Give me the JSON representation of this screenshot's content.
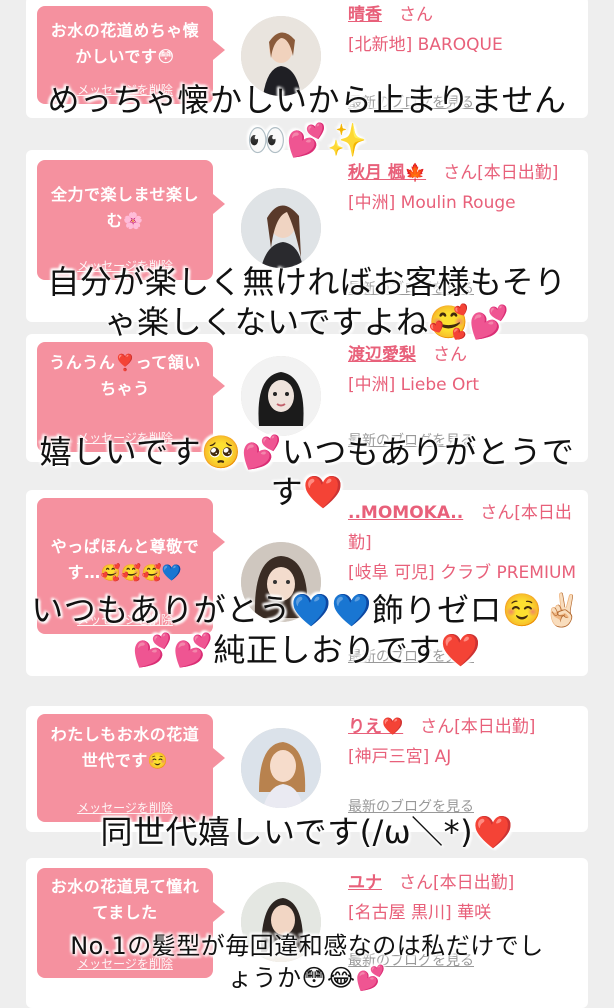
{
  "cards": [
    {
      "message": "お水の花道めちゃ懐かしいです😳",
      "delete_label": "メッセージを削除",
      "name": "晴香",
      "san": "さん",
      "status": "",
      "shop": "[北新地] BAROQUE",
      "blog_label": "最新のブログを見る"
    },
    {
      "message": "全力で楽しませ楽しむ🌸",
      "delete_label": "メッセージを削除",
      "name": "秋月 楓🍁",
      "san": "さん",
      "status": "[本日出勤]",
      "shop": "[中洲] Moulin Rouge",
      "blog_label": "最新のブログを見る"
    },
    {
      "message": "うんうん❣️って頷いちゃう",
      "delete_label": "メッセージを削除",
      "name": "渡辺愛梨",
      "san": "さん",
      "status": "",
      "shop": "[中洲] Liebe Ort",
      "blog_label": "最新のブログを見る"
    },
    {
      "message": "やっぱほんと尊敬です…🥰🥰🥰💙",
      "delete_label": "メッセージを削除",
      "name": "..MOMOKA..",
      "san": "さん",
      "status": "[本日出勤]",
      "shop": "[岐阜 可児] クラブ PREMIUM",
      "blog_label": "最新のブログを見る"
    },
    {
      "message": "わたしもお水の花道世代です☺️",
      "delete_label": "メッセージを削除",
      "name": "りえ❤️",
      "san": "さん",
      "status": "[本日出勤]",
      "shop": "[神戸三宮] AJ",
      "blog_label": "最新のブログを見る"
    },
    {
      "message": "お水の花道見て憧れてました",
      "delete_label": "メッセージを削除",
      "name": "ユナ",
      "san": "さん",
      "status": "[本日出勤]",
      "shop": "[名古屋 黒川] 華咲",
      "blog_label": "最新のブログを見る"
    }
  ],
  "overlays": [
    {
      "line1": "めっちゃ懐かしいから止まりません",
      "line2": "👀💕✨"
    },
    {
      "line1": "自分が楽しく無ければお客様もそり",
      "line2": "ゃ楽しくないですよね🥰💕"
    },
    {
      "line1": "嬉しいです🥺💕いつもありがとうで",
      "line2": "す❤️"
    },
    {
      "line1": "いつもありがとう💙💙飾りゼロ☺️✌🏻",
      "line2": "💕💕純正しおりです❤️"
    },
    {
      "line1": "同世代嬉しいです(/ω＼*)❤️",
      "line2": ""
    },
    {
      "line1": "No.1の髪型が毎回違和感なのは私だけでし",
      "line2": "ょうか😳😂💕"
    }
  ]
}
